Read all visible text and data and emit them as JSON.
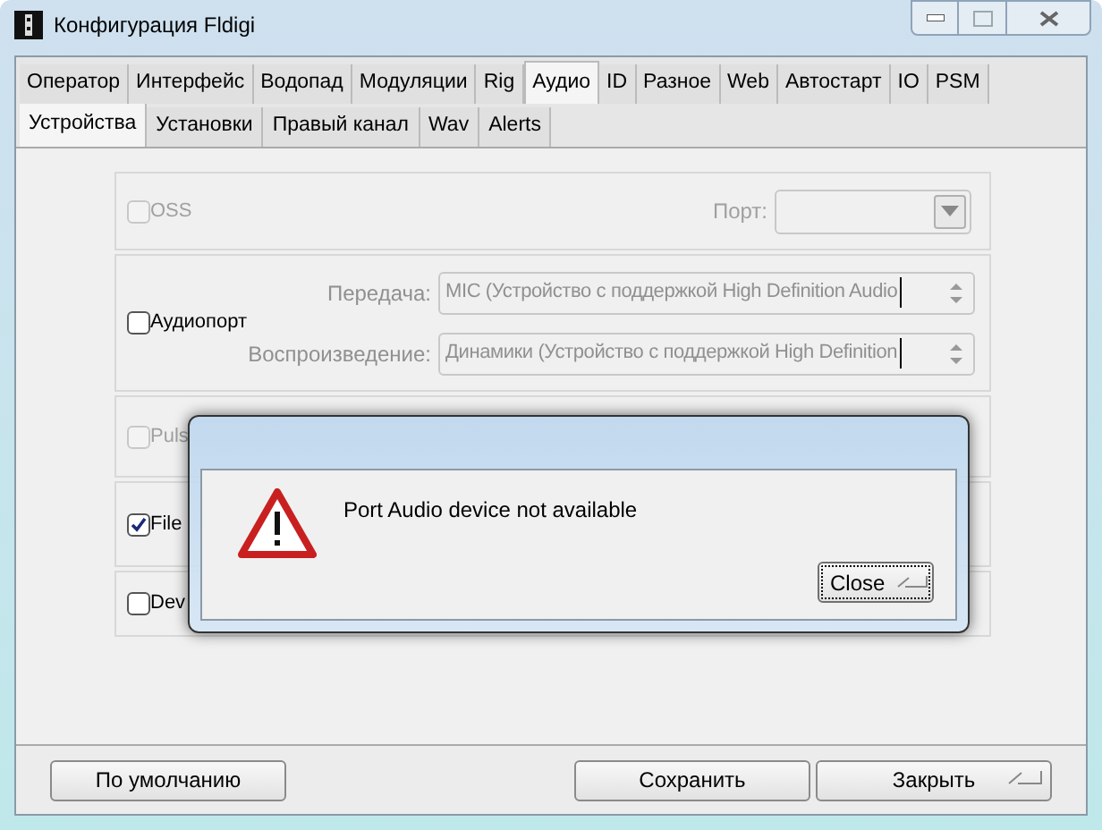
{
  "window": {
    "title": "Конфигурация Fldigi"
  },
  "tabs": [
    {
      "label": "Оператор",
      "selected": false
    },
    {
      "label": "Интерфейс",
      "selected": false
    },
    {
      "label": "Водопад",
      "selected": false
    },
    {
      "label": "Модуляции",
      "selected": false
    },
    {
      "label": "Rig",
      "selected": false
    },
    {
      "label": "Аудио",
      "selected": true
    },
    {
      "label": "ID",
      "selected": false
    },
    {
      "label": "Разное",
      "selected": false
    },
    {
      "label": "Web",
      "selected": false
    },
    {
      "label": "Автостарт",
      "selected": false
    },
    {
      "label": "IO",
      "selected": false
    },
    {
      "label": "PSM",
      "selected": false
    }
  ],
  "subtabs": [
    {
      "label": "Устройства",
      "selected": true
    },
    {
      "label": "Установки",
      "selected": false
    },
    {
      "label": "Правый канал",
      "selected": false
    },
    {
      "label": "Wav",
      "selected": false
    },
    {
      "label": "Alerts",
      "selected": false
    }
  ],
  "sections": [
    {
      "kind": "port",
      "label": "OSS",
      "checked": false,
      "disabled": true,
      "port_label": "Порт:"
    },
    {
      "kind": "devices",
      "label": "Аудиопорт",
      "checked": false,
      "disabled": false,
      "fields": [
        {
          "label": "Передача:",
          "value": "MIC (Устройство с поддержкой High Definition Audio"
        },
        {
          "label": "Воспроизведение:",
          "value": "Динамики (Устройство с поддержкой High Definition"
        }
      ]
    },
    {
      "kind": "plain",
      "label": "Puls",
      "checked": false,
      "disabled": true
    },
    {
      "kind": "plain",
      "label": "File",
      "checked": true,
      "disabled": false
    },
    {
      "kind": "plain",
      "label": "Dev",
      "checked": false,
      "disabled": false
    }
  ],
  "dialog": {
    "message": "Port Audio device not available",
    "button": "Close"
  },
  "buttons": [
    {
      "label": "По умолчанию",
      "kind": "left"
    },
    {
      "label": "Сохранить",
      "kind": "right"
    },
    {
      "label": "Закрыть",
      "kind": "enter"
    }
  ]
}
